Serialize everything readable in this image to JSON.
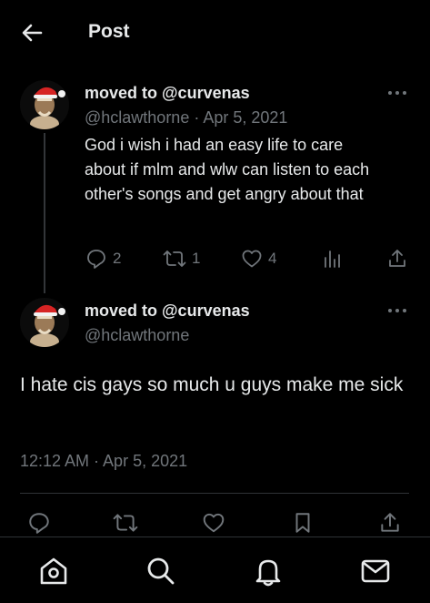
{
  "header": {
    "title": "Post",
    "back_icon": "arrow-left-icon"
  },
  "parent_post": {
    "display_name": "moved to @curvenas",
    "handle_date": "@hclawthorne · Apr 5, 2021",
    "text": "God i wish i had an easy life to care about if mlm and wlw can listen to each other's songs and get angry about that",
    "replies": "2",
    "reposts": "1",
    "likes": "4"
  },
  "main_post": {
    "display_name": "moved to @curvenas",
    "handle": "@hclawthorne",
    "text": "I hate cis gays so much u guys make me sick",
    "timestamp": "12:12 AM · Apr 5, 2021"
  },
  "nav": {
    "items": [
      "home-icon",
      "search-icon",
      "bell-icon",
      "mail-icon"
    ]
  },
  "colors": {
    "background": "#000000",
    "primary_text": "#e7e9ea",
    "secondary_text": "#71767b",
    "border": "#2f3336"
  }
}
